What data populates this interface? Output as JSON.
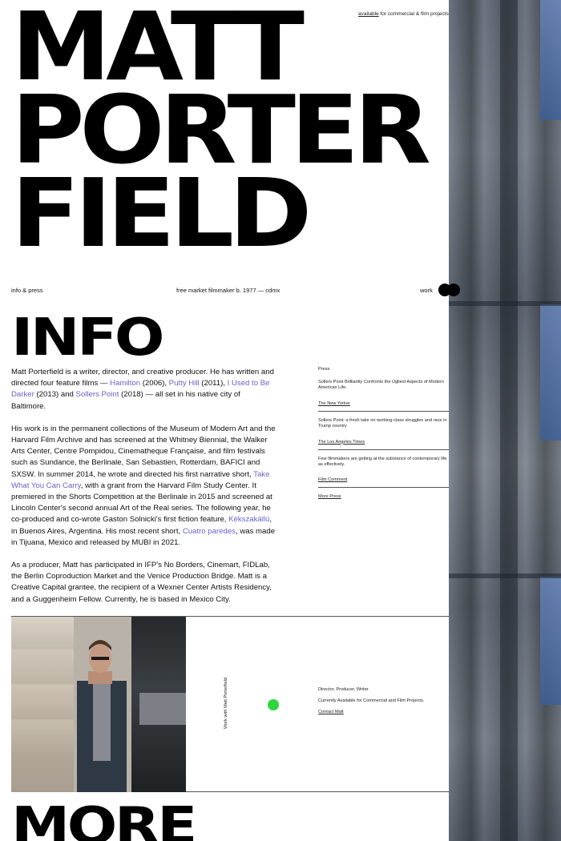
{
  "header": {
    "name_lines": [
      "MATT",
      "PORTER",
      "FIELD"
    ],
    "availability_link": "available",
    "availability_rest": " for commercial & film projects"
  },
  "nav": {
    "left": "info & press",
    "center": "free market filmmaker b. 1977 — cdmx",
    "right": "work"
  },
  "info": {
    "title": "INFO",
    "bio": [
      [
        {
          "t": "Matt Porterfield is a writer, director, and creative producer. He has written and directed four feature films — "
        },
        {
          "t": "Hamilton",
          "link": true
        },
        {
          "t": " (2006), "
        },
        {
          "t": "Putty Hill",
          "link": true
        },
        {
          "t": " (2011), "
        },
        {
          "t": "I Used to Be Darker",
          "link": true
        },
        {
          "t": " (2013) and "
        },
        {
          "t": "Sollers Point",
          "link": true
        },
        {
          "t": " (2018) — all set in his native city of Baltimore."
        }
      ],
      [
        {
          "t": "His work is in the permanent collections of the Museum of Modern Art and the Harvard Film Archive and has screened at the Whitney Biennial, the Walker Arts Center, Centre Pompidou, Cinematheque Française, and film festivals such as Sundance, the Berlinale, San Sebastien, Rotterdam, BAFICI and SXSW. In summer 2014, he wrote and directed his first narrative short, "
        },
        {
          "t": "Take What You Can Carry",
          "link": true
        },
        {
          "t": ", with a grant from the Harvard Film Study Center. It premiered in the Shorts Competition at the Berlinale in 2015 and screened at Lincoln Center's second annual Art of the Real series. The following year, he co-produced and co-wrote Gaston Solnicki's first fiction feature, "
        },
        {
          "t": "Kékszakállú",
          "link": true
        },
        {
          "t": ", in Buenos Aires, Argentina. His most recent short, "
        },
        {
          "t": "Cuatro paredes",
          "link": true
        },
        {
          "t": ", was made in Tijuana, Mexico and released by MUBI in 2021."
        }
      ],
      [
        {
          "t": "As a producer, Matt has participated in IFP's No Borders, Cinemart, FIDLab, the Berlin Coproduction Market and the Venice Production Bridge. Matt is a Creative Capital grantee, the recipient of a Wexner Center Artists Residency, and a Guggenheim Fellow. Currently, he is based in Mexico City."
        }
      ]
    ]
  },
  "press": {
    "heading": "Press",
    "items": [
      {
        "quote": "Sollers Point Brilliantly Confronts the Ugliest Aspects of Modern American Life.",
        "source": "The New Yorker"
      },
      {
        "quote": "Sollers Point: a fresh take on working-class struggles and race in Trump country",
        "source": "The Los Angeles Times"
      },
      {
        "quote": "Few filmmakers are getting at the substance of contemporary life as effectively.",
        "source": "Film Comment"
      }
    ],
    "more": "More Press"
  },
  "contact": {
    "vertical_label": "Work with Matt Porterfield",
    "role": "Director, Producer, Writer",
    "availability": "Currently Available for Commercial and Film Projects.",
    "link": "Contact Matt",
    "dot_color": "#2ed63b",
    "photo_icon": "portrait-photo"
  },
  "more": {
    "title": "MORE"
  },
  "colors": {
    "link": "#6b62c9",
    "accent_dot": "#2ed63b"
  }
}
